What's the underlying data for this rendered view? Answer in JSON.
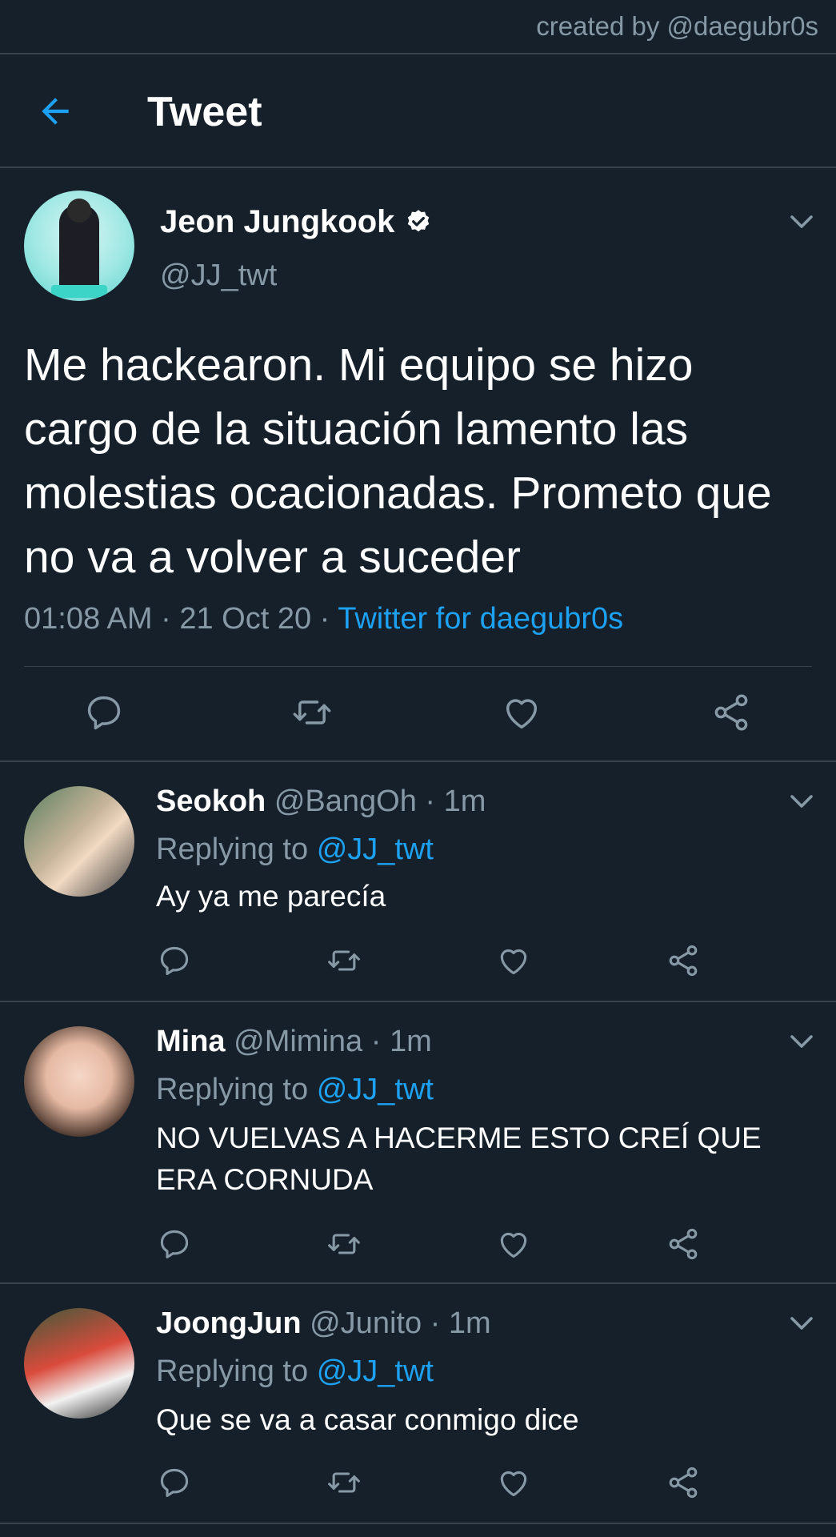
{
  "credit": "created by @daegubr0s",
  "header": {
    "title": "Tweet"
  },
  "tweet": {
    "name": "Jeon Jungkook",
    "handle": "@JJ_twt",
    "text": "Me hackearon. Mi equipo se hizo cargo de la situación lamento las molestias ocacionadas. Prometo que no va a volver a suceder",
    "time": "01:08 AM",
    "date": "21 Oct 20",
    "separator": "·",
    "source": "Twitter for daegubr0s"
  },
  "replying_label": "Replying to",
  "replies": [
    {
      "name": "Seokoh",
      "handle": "@BangOh",
      "dot": "·",
      "age": "1m",
      "replying_to": "@JJ_twt",
      "text": "Ay ya me parecía"
    },
    {
      "name": "Mina",
      "handle": "@Mimina",
      "dot": "·",
      "age": "1m",
      "replying_to": "@JJ_twt",
      "text": "NO VUELVAS A HACERME ESTO CREÍ QUE ERA CORNUDA"
    },
    {
      "name": "JoongJun",
      "handle": "@Junito",
      "dot": "·",
      "age": "1m",
      "replying_to": "@JJ_twt",
      "text": "Que se va a casar conmigo dice"
    }
  ],
  "icons": [
    "back-arrow-icon",
    "verified-badge-icon",
    "chevron-down-icon",
    "reply-icon",
    "retweet-icon",
    "like-icon",
    "share-icon"
  ],
  "colors": {
    "background": "#15202b",
    "accent": "#1da1f2",
    "secondary_text": "#8899a6",
    "divider": "#38444d"
  }
}
